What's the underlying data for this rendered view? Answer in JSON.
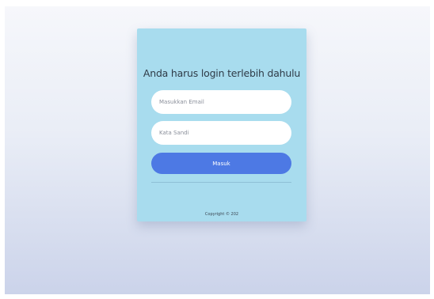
{
  "login": {
    "title": "Anda harus login terlebih dahulu",
    "email_placeholder": "Masukkan Email",
    "password_placeholder": "Kata Sandi",
    "submit_label": "Masuk",
    "copyright": "Copyright © 202"
  },
  "colors": {
    "card_background": "#a8dcee",
    "button": "#4d79e4",
    "input_background": "#ffffff"
  }
}
